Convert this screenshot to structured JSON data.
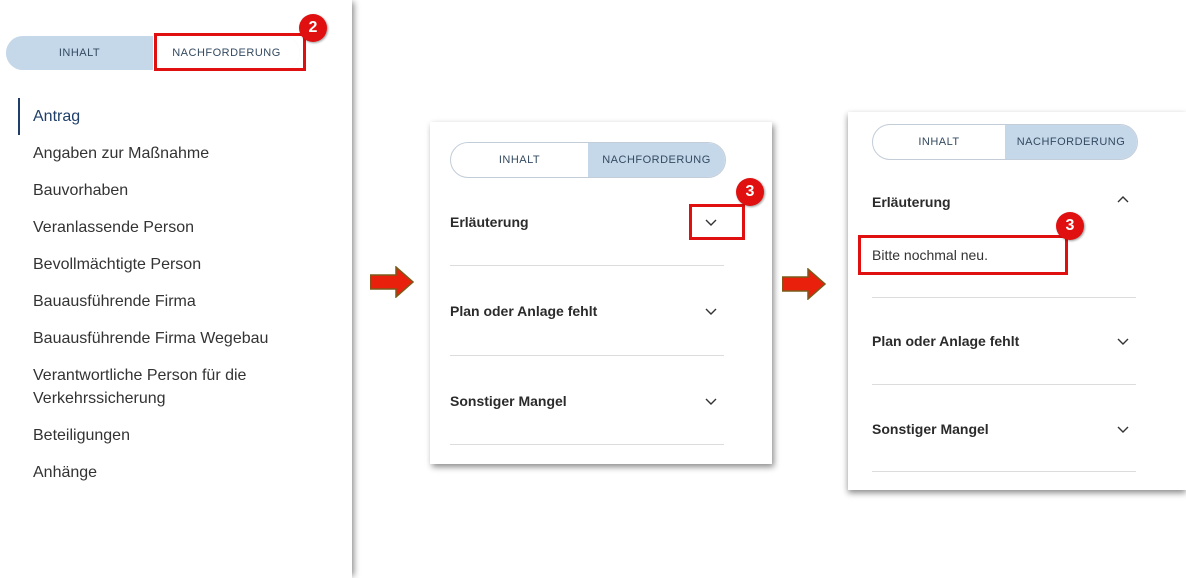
{
  "panel1": {
    "toggle": {
      "left": "INHALT",
      "right": "NACHFORDERUNG"
    },
    "nav": [
      "Antrag",
      "Angaben zur Maßnahme",
      "Bauvorhaben",
      "Veranlassende Person",
      "Bevollmächtigte Person",
      "Bauausführende Firma",
      "Bauausführende Firma Wegebau",
      "Verantwortliche Person für die Verkehrssicherung",
      "Beteiligungen",
      "Anhänge"
    ],
    "badge": "2"
  },
  "panel2": {
    "toggle": {
      "left": "INHALT",
      "right": "NACHFORDERUNG"
    },
    "items": [
      "Erläuterung",
      "Plan oder Anlage fehlt",
      "Sonstiger Mangel"
    ],
    "badge": "3"
  },
  "panel3": {
    "toggle": {
      "left": "INHALT",
      "right": "NACHFORDERUNG"
    },
    "items": [
      "Erläuterung",
      "Plan oder Anlage fehlt",
      "Sonstiger Mangel"
    ],
    "expanded_text": "Bitte nochmal neu.",
    "badge": "3"
  },
  "colors": {
    "highlight": "#e01010",
    "toggle_active": "#c5d8ea",
    "nav_active": "#1f3f6a"
  }
}
